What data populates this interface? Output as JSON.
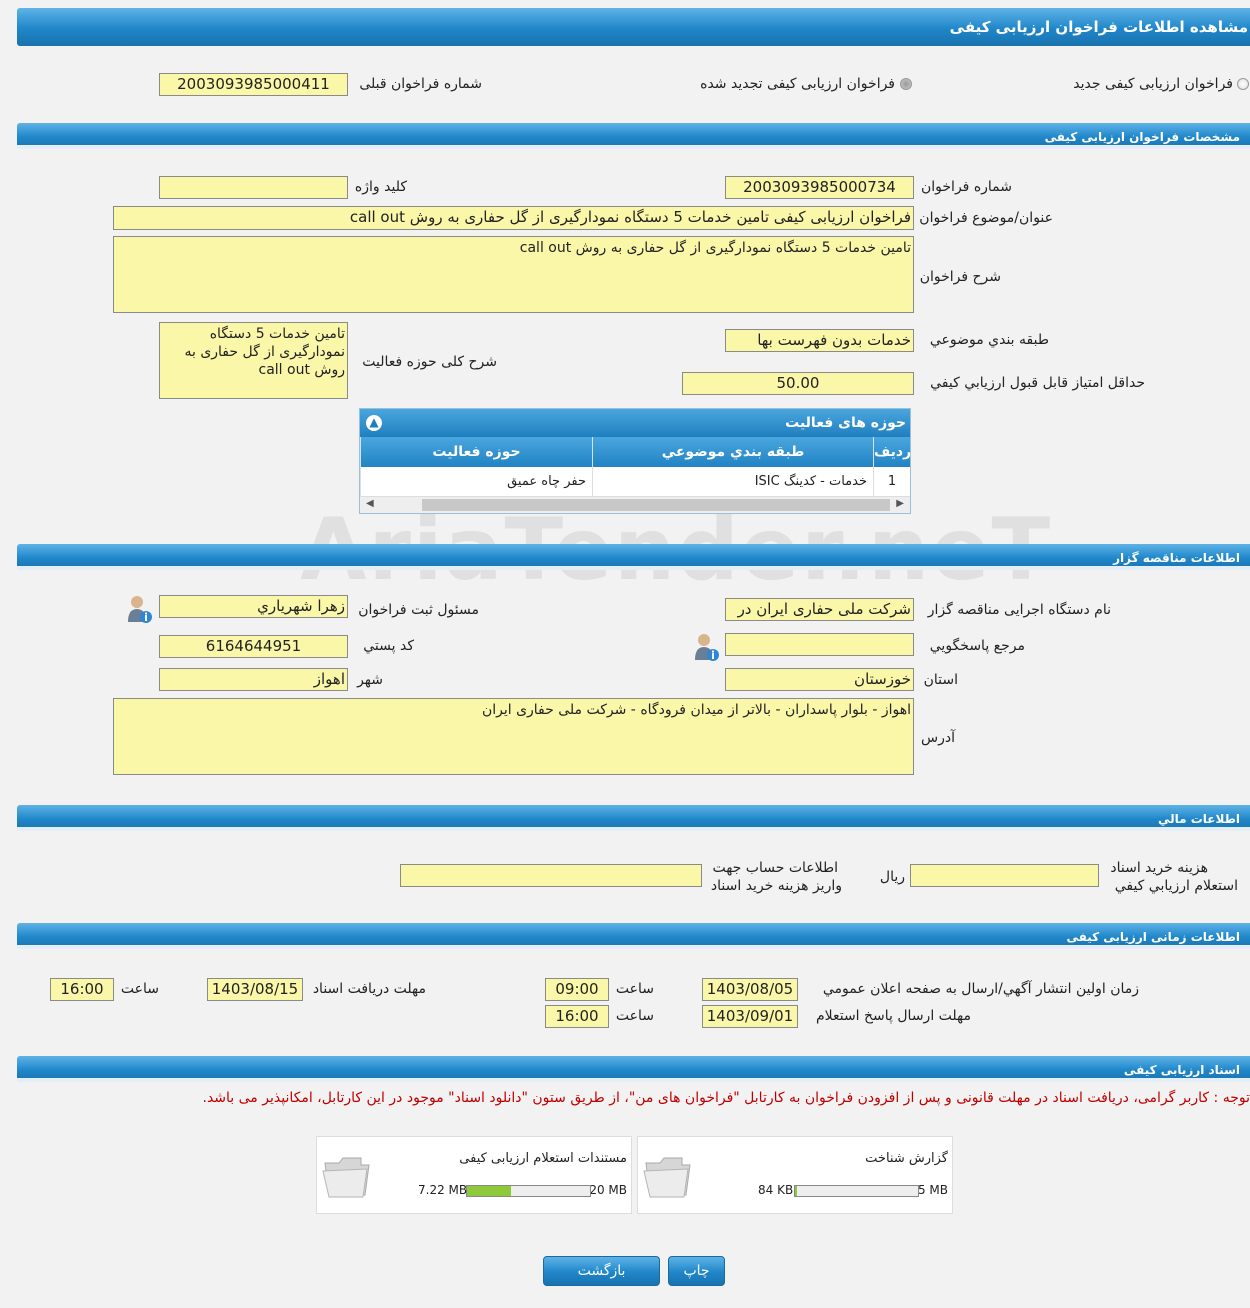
{
  "header": {
    "title": "مشاهده اطلاعات فراخوان ارزيابی کيفی"
  },
  "top": {
    "radio_new": "فراخوان ارزيابی کيفی جديد",
    "radio_renewed": "فراخوان ارزيابی کيفی تجديد شده",
    "prev_number_label": "شماره فراخوان قبلی",
    "prev_number": "2003093985000411"
  },
  "spec": {
    "section_title": "مشخصات فراخوان ارزيابی کيفی",
    "number_label": "شماره فراخوان",
    "number": "2003093985000734",
    "keyword_label": "کليد واژه",
    "keyword": "",
    "title_label": "عنوان/موضوع فراخوان",
    "title": "فراخوان ارزیابی کیفی تامین خدمات 5 دستگاه نمودارگیری از گل حفاری به روش call out",
    "desc_label": "شرح فراخوان",
    "desc": "تامین خدمات 5 دستگاه نمودارگیری از گل حفاری به روش call out",
    "category_label": "طبقه بندي موضوعي",
    "category": "خدمات بدون فهرست بها",
    "activity_desc_label": "شرح کلی حوزه فعالیت",
    "activity_desc": "تامین خدمات 5 دستگاه نمودارگیری از گل حفاری به روش call out",
    "min_score_label": "حداقل امتياز قابل قبول ارزيابي کيفي",
    "min_score": "50.00"
  },
  "activity_grid": {
    "title": "حوزه های فعالیت",
    "col_row": "رديف",
    "col_category": "طبقه بندي موضوعي",
    "col_field": "حوزه فعاليت",
    "rows": [
      {
        "n": "1",
        "category": "خدمات - کدينگ ISIC",
        "field": "حفر چاه عمیق"
      }
    ]
  },
  "watermark": "AriaTender.neT",
  "org": {
    "section_title": "اطلاعات مناقصه گزار",
    "org_label": "نام دستگاه اجرایی مناقصه گزار",
    "org_name": "شرکت ملی حفاری ایران در",
    "registrar_label": "مسئول ثبت فراخوان",
    "registrar": "زهرا شهرياري",
    "ref_label": "مرجع پاسخگويي",
    "ref": "",
    "postal_label": "کد پستي",
    "postal": "6164644951",
    "province_label": "استان",
    "province": "خوزستان",
    "city_label": "شهر",
    "city": "اهواز",
    "address_label": "آدرس",
    "address": "اهواز - بلوار پاسداران - بالاتر از میدان فرودگاه - شرکت ملی حفاری ایران"
  },
  "finance": {
    "section_title": "اطلاعات مالي",
    "fee_label_1": "هزينه خريد اسناد",
    "fee_label_2": "استعلام ارزيابي کيفي",
    "fee": "",
    "currency": "ريال",
    "account_label_1": "اطلاعات حساب جهت",
    "account_label_2": "واريز هزينه خريد اسناد",
    "account": ""
  },
  "timing": {
    "section_title": "اطلاعات زمانی ارزيابی کيفی",
    "publish_label": "زمان اولين انتشار آگهي/ارسال به صفحه اعلان عمومي",
    "publish_date": "1403/08/05",
    "time_label": "ساعت",
    "publish_time": "09:00",
    "doc_deadline_label": "مهلت دریافت اسناد",
    "doc_deadline_date": "1403/08/15",
    "doc_deadline_time": "16:00",
    "response_label": "مهلت ارسال پاسخ استعلام",
    "response_date": "1403/09/01",
    "response_time": "16:00"
  },
  "docs": {
    "section_title": "اسناد ارزيابی کيفی",
    "notice": "توجه : کاربر گرامی، دریافت اسناد در مهلت قانونی و پس از افزودن فراخوان به کارتابل \"فراخوان های من\"، از طریق ستون \"دانلود اسناد\" موجود در این کارتابل، امکانپذیر می باشد.",
    "files": [
      {
        "title": "گزارش شناخت",
        "used": "84 KB",
        "max": "5 MB",
        "fraction": 0.016
      },
      {
        "title": "مستندات استعلام ارزيابی کيفی",
        "used": "7.22 MB",
        "max": "20 MB",
        "fraction": 0.361
      }
    ]
  },
  "buttons": {
    "back": "بازگشت",
    "print": "چاپ"
  }
}
